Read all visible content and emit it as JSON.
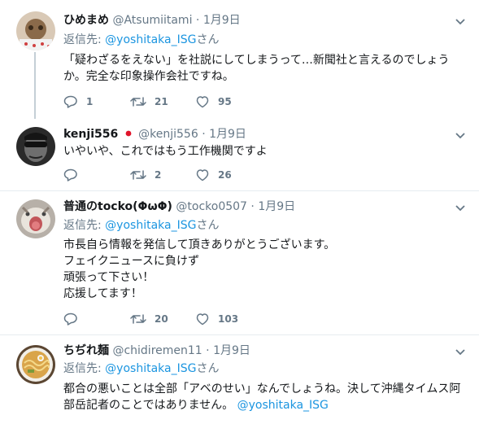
{
  "tweets": [
    {
      "name": "ひめまめ",
      "handle": "@Atsumiitami",
      "dot": "·",
      "time": "1月9日",
      "reply_prefix": "返信先: ",
      "reply_user": "@yoshitaka_ISG",
      "reply_suffix": "さん",
      "text": "「疑わざるをえない」を社説にしてしまうって…新聞社と言えるのでしょうか。完全な印象操作会社ですね。",
      "replies": "1",
      "retweets": "21",
      "likes": "95"
    },
    {
      "name": "kenji556",
      "handle": "@kenji556",
      "dot": "·",
      "time": "1月9日",
      "text": "いやいや、これではもう工作機関ですよ",
      "replies": "",
      "retweets": "2",
      "likes": "26"
    },
    {
      "name": "普通のtocko(ΦωΦ)",
      "handle": "@tocko0507",
      "dot": "·",
      "time": "1月9日",
      "reply_prefix": "返信先: ",
      "reply_user": "@yoshitaka_ISG",
      "reply_suffix": "さん",
      "lines": [
        "市長自ら情報を発信して頂きありがとうございます。",
        "フェイクニュースに負けず",
        "頑張って下さい！",
        "応援してます！"
      ],
      "replies": "",
      "retweets": "20",
      "likes": "103"
    },
    {
      "name": "ちぢれ麺",
      "handle": "@chidiremen11",
      "dot": "·",
      "time": "1月9日",
      "reply_prefix": "返信先: ",
      "reply_user": "@yoshitaka_ISG",
      "reply_suffix": "さん",
      "text_main": "都合の悪いことは全部「アベのせい」なんでしょうね。決して沖縄タイムス阿部岳記者のことではありません。",
      "text_mention": "@yoshitaka_ISG"
    }
  ],
  "colors": {
    "link": "#1b95e0",
    "muted": "#657786",
    "border": "#e6ecf0",
    "thread": "#c4cfd6"
  },
  "icons": [
    "reply-icon",
    "retweet-icon",
    "like-icon",
    "chevron-down-icon",
    "japan-flag-icon"
  ]
}
